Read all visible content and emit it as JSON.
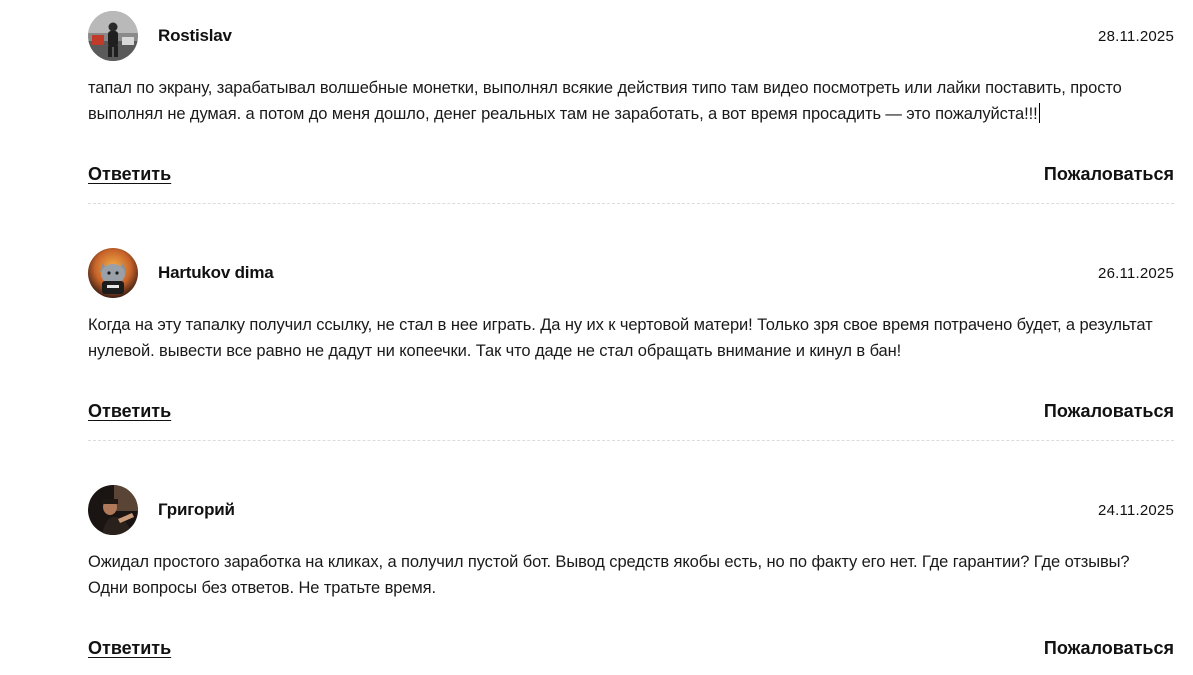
{
  "comments": [
    {
      "author": "Rostislav",
      "date": "28.11.2025",
      "avatar_icon": "person-photo-avatar",
      "text": "тапал по экрану, зарабатывал волшебные монетки, выполнял всякие действия типо там видео посмотреть или лайки поставить, просто выполнял не думая. а потом до меня дошло, денег реальных там не заработать, а вот время просадить — это пожалуйста!!!",
      "reply_label": "Ответить",
      "report_label": "Пожаловаться"
    },
    {
      "author": "Hartukov dima",
      "date": "26.11.2025",
      "avatar_icon": "cat-character-avatar",
      "text": "Когда на эту тапалку получил ссылку, не стал в нее играть. Да ну их к чертовой матери! Только зря свое время потрачено будет, а результат нулевой. вывести все равно не дадут ни копеечки. Так что даде не стал обращать внимание и кинул в бан!",
      "reply_label": "Ответить",
      "report_label": "Пожаловаться"
    },
    {
      "author": "Григорий",
      "date": "24.11.2025",
      "avatar_icon": "person-photo-avatar",
      "text": "Ожидал простого заработка на кликах, а получил пустой бот. Вывод средств якобы есть, но по факту его нет. Где гарантии? Где отзывы? Одни вопросы без ответов. Не тратьте время.",
      "reply_label": "Ответить",
      "report_label": "Пожаловаться"
    }
  ]
}
